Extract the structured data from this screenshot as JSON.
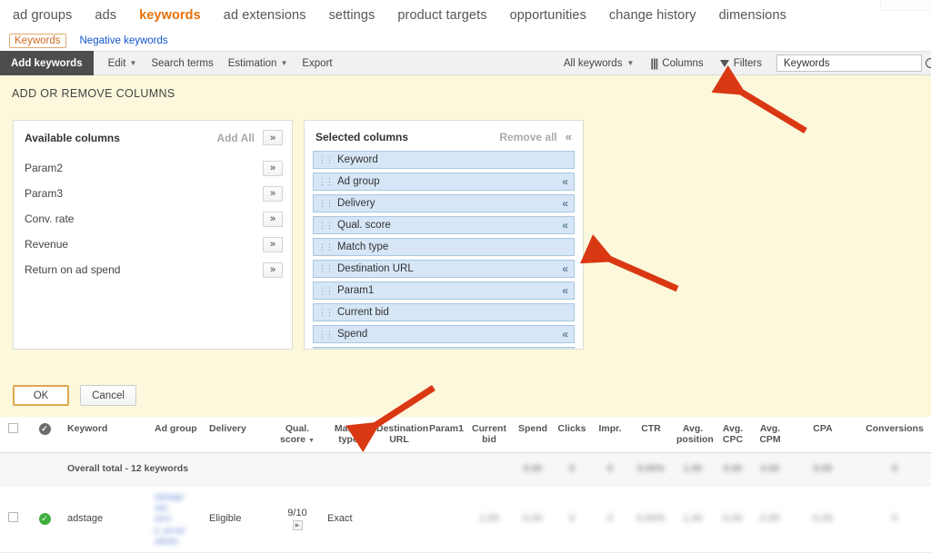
{
  "topnav": {
    "items": [
      {
        "label": "ad groups",
        "active": false
      },
      {
        "label": "ads",
        "active": false
      },
      {
        "label": "keywords",
        "active": true
      },
      {
        "label": "ad extensions",
        "active": false
      },
      {
        "label": "settings",
        "active": false
      },
      {
        "label": "product targets",
        "active": false
      },
      {
        "label": "opportunities",
        "active": false
      },
      {
        "label": "change history",
        "active": false
      },
      {
        "label": "dimensions",
        "active": false
      }
    ]
  },
  "subtabs": [
    {
      "label": "Keywords",
      "active": true
    },
    {
      "label": "Negative keywords",
      "active": false
    }
  ],
  "toolbar": {
    "add_keywords_label": "Add keywords",
    "edit_label": "Edit",
    "search_terms_label": "Search terms",
    "estimation_label": "Estimation",
    "export_label": "Export",
    "all_keywords_label": "All keywords",
    "columns_label": "Columns",
    "filters_label": "Filters",
    "search_value": "Keywords",
    "search_placeholder": "Keywords"
  },
  "dialog": {
    "title": "ADD OR REMOVE COLUMNS",
    "available": {
      "heading": "Available columns",
      "action_label": "Add All",
      "add_glyph": "»",
      "items": [
        {
          "label": "Param2"
        },
        {
          "label": "Param3"
        },
        {
          "label": "Conv. rate"
        },
        {
          "label": "Revenue"
        },
        {
          "label": "Return on ad spend"
        }
      ]
    },
    "selected": {
      "heading": "Selected columns",
      "action_label": "Remove all",
      "remove_glyph": "«",
      "grip_glyph": "⁙",
      "items": [
        {
          "label": "Keyword",
          "removable": false
        },
        {
          "label": "Ad group",
          "removable": true
        },
        {
          "label": "Delivery",
          "removable": true
        },
        {
          "label": "Qual. score",
          "removable": true
        },
        {
          "label": "Match type",
          "removable": false
        },
        {
          "label": "Destination URL",
          "removable": true
        },
        {
          "label": "Param1",
          "removable": true
        },
        {
          "label": "Current bid",
          "removable": false
        },
        {
          "label": "Spend",
          "removable": true
        }
      ]
    },
    "ok_label": "OK",
    "cancel_label": "Cancel"
  },
  "table": {
    "headers": [
      "Keyword",
      "Ad group",
      "Delivery",
      "Qual. score",
      "Match type",
      "Destination URL",
      "Param1",
      "Current bid",
      "Spend",
      "Clicks",
      "Impr.",
      "CTR",
      "Avg. position",
      "Avg. CPC",
      "Avg. CPM",
      "CPA",
      "Conversions"
    ],
    "sorted_column": "Qual. score",
    "totals_row": {
      "label": "Overall total - 12 keywords",
      "spend": "0.00",
      "clicks": "0",
      "impr": "0",
      "ctr": "0.00%",
      "avg_position": "1.00",
      "avg_cpc": "0.00",
      "avg_cpm": "0.00",
      "cpa": "0.00",
      "conversions": "0"
    },
    "rows": [
      {
        "keyword": "adstage",
        "ad_group": "adstage\nads\nad-b\nb_ad-ad\nadwds",
        "delivery": "Eligible",
        "qual_score": "9/10",
        "match_type": "Exact",
        "destination_url": "",
        "param1": "",
        "current_bid": "1.00",
        "spend": "0.00",
        "clicks": "0",
        "impr": "0",
        "ctr": "0.00%",
        "avg_position": "1.00",
        "avg_cpc": "0.00",
        "avg_cpm": "0.00",
        "cpa": "0.00",
        "conversions": "0",
        "status": "enabled"
      }
    ]
  },
  "annotations": {
    "arrow_color": "#d93812",
    "arrows": [
      {
        "name": "arrow-to-columns-button"
      },
      {
        "name": "arrow-to-selected-columns"
      },
      {
        "name": "arrow-to-qual-score-header"
      }
    ]
  }
}
